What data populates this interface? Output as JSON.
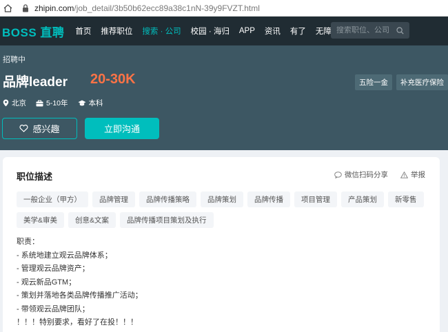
{
  "browser": {
    "url_host": "zhipin.com",
    "url_path": "/job_detail/3b50b62ecc89a38c1nN-39y9FVZT.html"
  },
  "nav": {
    "logo": "BOSS 直聘",
    "items": [
      {
        "label": "首页",
        "active": false
      },
      {
        "label": "推荐职位",
        "active": false
      },
      {
        "label": "搜索 · 公司",
        "active": true
      },
      {
        "label": "校园 · 海归",
        "active": false
      },
      {
        "label": "APP",
        "active": false
      },
      {
        "label": "资讯",
        "active": false
      },
      {
        "label": "有了",
        "active": false
      },
      {
        "label": "无障碍专区",
        "active": false
      }
    ],
    "search_placeholder": "搜索职位、公司"
  },
  "job": {
    "status": "招聘中",
    "title": "品牌leader",
    "salary": "20-30K",
    "benefits": [
      "五险一金",
      "补充医疗保险"
    ],
    "city": "北京",
    "experience": "5-10年",
    "education": "本科",
    "interest_label": "感兴趣",
    "chat_label": "立即沟通"
  },
  "description": {
    "title": "职位描述",
    "share_label": "微信扫码分享",
    "report_label": "举报",
    "tags": [
      "一般企业（甲方）",
      "品牌管理",
      "品牌传播策略",
      "品牌策划",
      "品牌传播",
      "项目管理",
      "产品策划",
      "新零售",
      "美学&审美",
      "创意&文案",
      "品牌传播项目策划及执行"
    ],
    "lines": [
      "职责：",
      "- 系统地建立观云品牌体系；",
      "- 管理观云品牌资产；",
      "- 观云新品GTM；",
      "- 策划并落地各类品牌传播推广活动；",
      "- 带领观云品牌团队；",
      "！！！特别要求，看好了在投！！！"
    ]
  },
  "colors": {
    "accent": "#00bebd",
    "nav_bg": "#202c33",
    "banner_bg": "#3d5763",
    "salary": "#fd7346"
  }
}
